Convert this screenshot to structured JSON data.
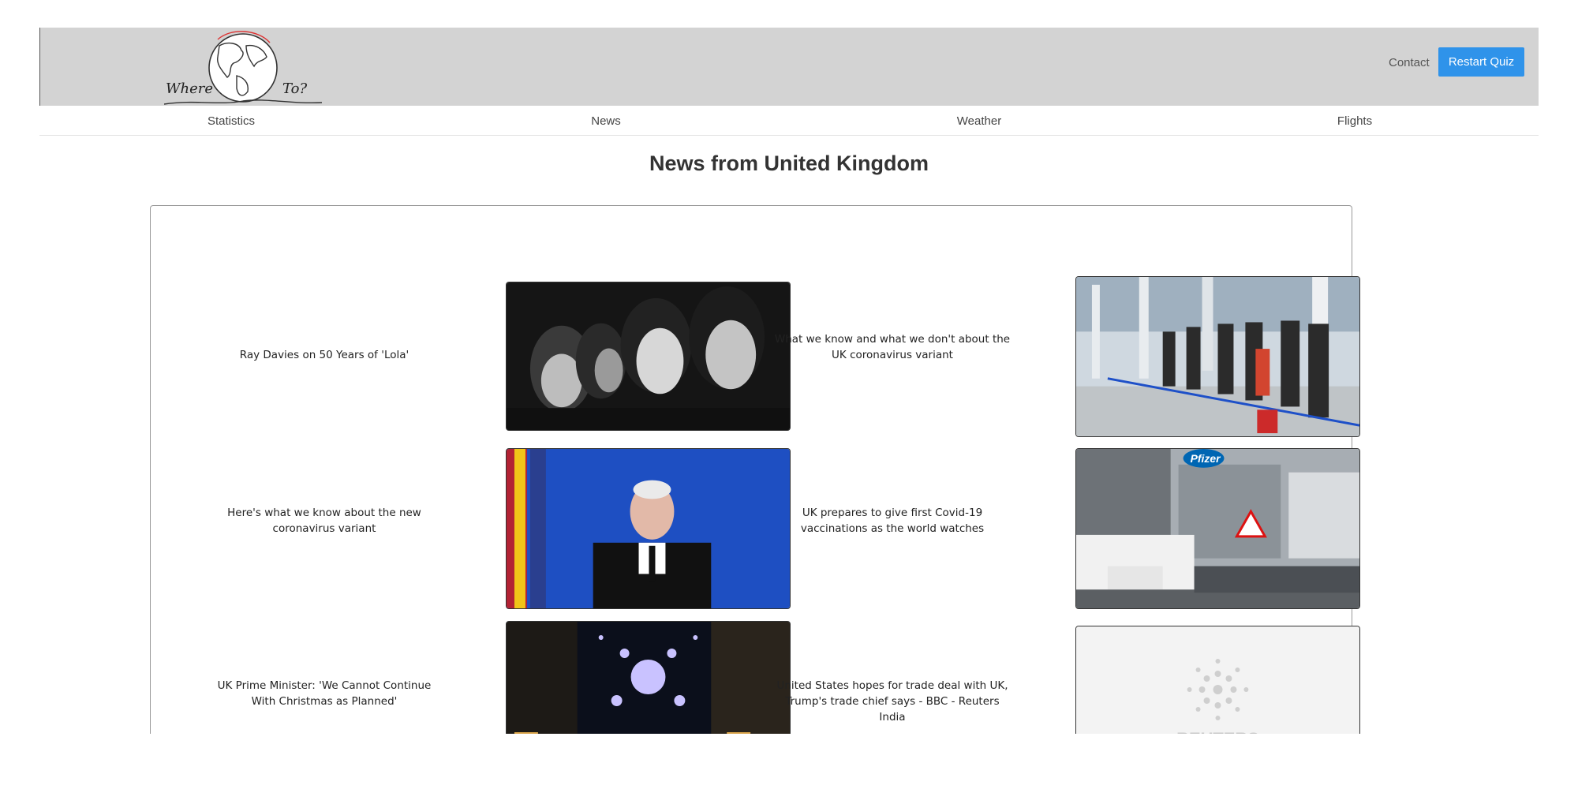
{
  "header": {
    "logo_text_left": "Where",
    "logo_text_right": "To?",
    "contact_label": "Contact",
    "restart_label": "Restart Quiz"
  },
  "nav": {
    "items": [
      {
        "label": "Statistics"
      },
      {
        "label": "News"
      },
      {
        "label": "Weather"
      },
      {
        "label": "Flights"
      }
    ]
  },
  "page": {
    "title": "News from United Kingdom"
  },
  "news": {
    "articles": [
      {
        "headline": "Ray Davies on 50 Years of 'Lola'",
        "image": "band-photo"
      },
      {
        "headline": "What we know and what we don't about the UK coronavirus variant",
        "image": "station-queue-photo"
      },
      {
        "headline": "Here's what we know about the new coronavirus variant",
        "image": "official-speaking-photo"
      },
      {
        "headline": "UK prepares to give first Covid-19 vaccinations as the world watches",
        "image": "pfizer-truck-photo"
      },
      {
        "headline": "UK Prime Minister: 'We Cannot Continue With Christmas as Planned'",
        "image": "christmas-street-photo"
      },
      {
        "headline": "United States hopes for trade deal with UK, Trump's trade chief says - BBC - Reuters India",
        "image": "reuters-logo"
      }
    ],
    "reuters_wordmark": "REUTERS",
    "pfizer_wordmark": "Pfizer"
  },
  "colors": {
    "header_bg": "#d3d3d3",
    "accent": "#2f93ea"
  }
}
